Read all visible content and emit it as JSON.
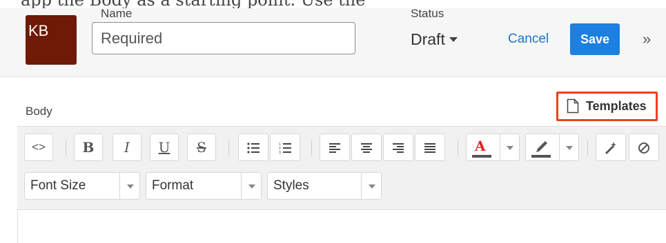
{
  "top_caption": "app the Body as a starting point. Use the",
  "header": {
    "avatar_initials": "KB",
    "name_label": "Name",
    "name_placeholder": "Required",
    "status_label": "Status",
    "status_value": "Draft",
    "cancel_label": "Cancel",
    "save_label": "Save",
    "more_label": "»"
  },
  "body_section": {
    "body_label": "Body",
    "templates_label": "Templates"
  },
  "toolbar": {
    "code_label": "<>",
    "bold_label": "B",
    "italic_label": "I",
    "underline_label": "U",
    "strike_label": "S",
    "font_color_label": "A"
  },
  "selects": {
    "font_size": "Font Size",
    "format": "Format",
    "styles": "Styles"
  },
  "colors": {
    "avatar": "#6e1a06",
    "save": "#1d7fe0",
    "link": "#1a73c8",
    "highlight_border": "#f03d21",
    "font_color": "#e02020"
  },
  "icons": [
    "file-icon",
    "bulleted-list-icon",
    "numbered-list-icon",
    "align-left-icon",
    "align-center-icon",
    "align-right-icon",
    "align-justify-icon",
    "font-color-icon",
    "highlighter-icon",
    "magic-wand-icon",
    "clear-format-icon"
  ]
}
